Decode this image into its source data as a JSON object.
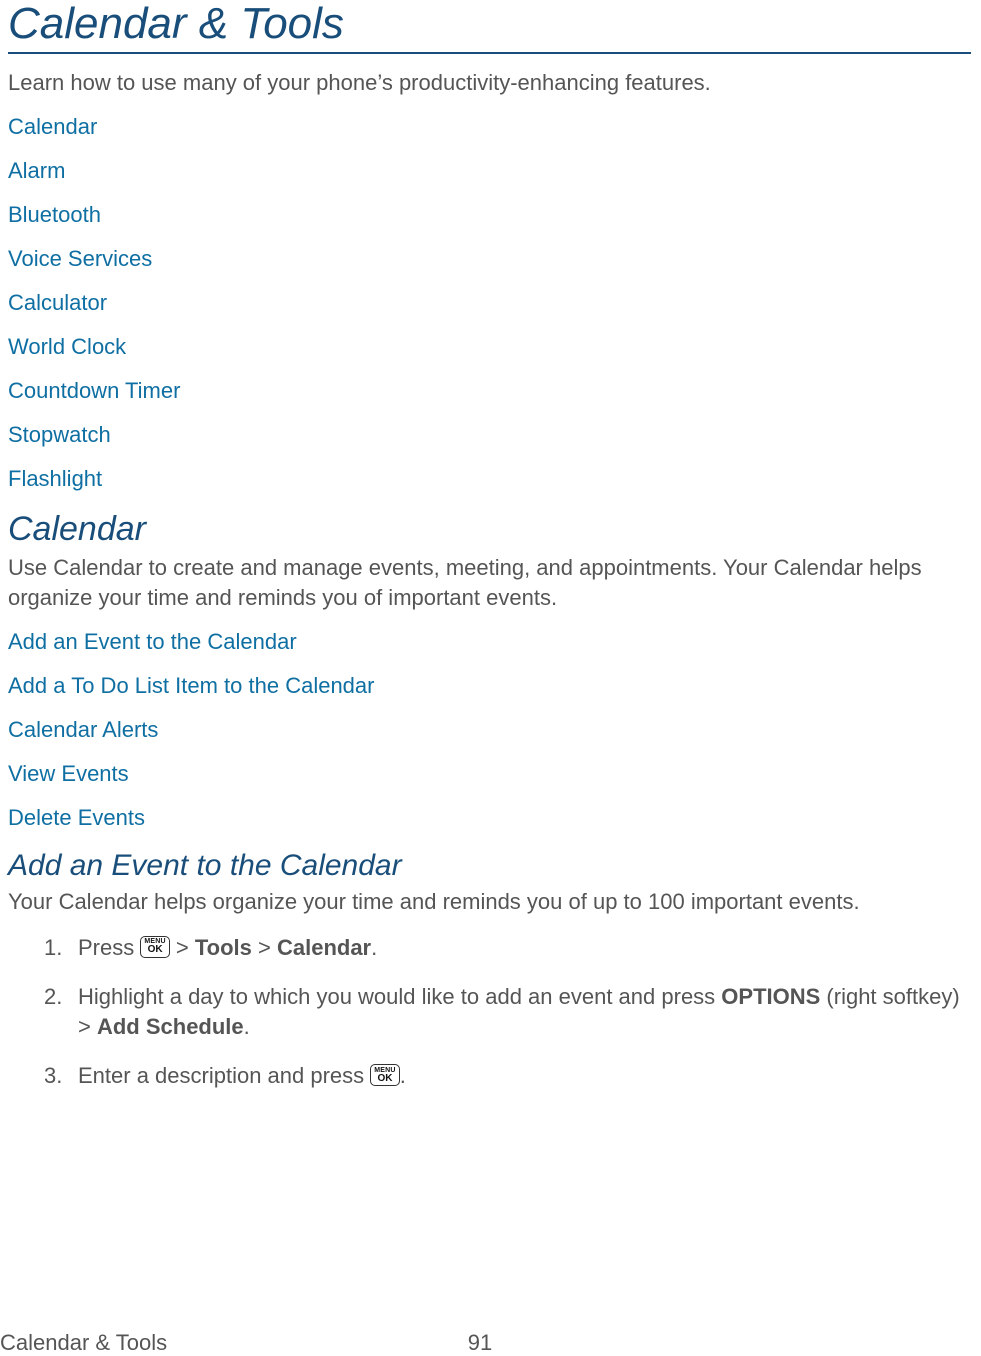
{
  "header": {
    "title": "Calendar & Tools",
    "intro": "Learn how to use many of your phone’s productivity-enhancing features."
  },
  "top_links": [
    "Calendar",
    "Alarm",
    "Bluetooth",
    "Voice Services",
    "Calculator",
    "World Clock",
    "Countdown Timer",
    "Stopwatch",
    "Flashlight"
  ],
  "section_calendar": {
    "title": "Calendar",
    "intro": "Use Calendar to create and manage events, meeting, and appointments. Your Calendar helps organize your time and reminds you of important events.",
    "links": [
      "Add an Event to the Calendar",
      "Add a To Do List Item to the Calendar",
      "Calendar Alerts",
      "View Events",
      "Delete Events"
    ]
  },
  "section_add_event": {
    "title": "Add an Event to the Calendar",
    "intro": "Your Calendar helps organize your time and reminds you of up to 100 important events.",
    "steps": {
      "s1_a": "Press ",
      "s1_gt1": " > ",
      "s1_tools": "Tools",
      "s1_gt2": " > ",
      "s1_calendar": "Calendar",
      "s1_period": ".",
      "s2_a": "Highlight a day to which you would like to add an event and press ",
      "s2_options": "OPTIONS",
      "s2_b": " (right softkey) > ",
      "s2_addsched": "Add Schedule",
      "s2_period": ".",
      "s3_a": "Enter a description and press ",
      "s3_period": "."
    }
  },
  "button_icon": {
    "line1": "MENU",
    "line2": "OK"
  },
  "footer": {
    "left": "Calendar & Tools",
    "page": "91"
  }
}
